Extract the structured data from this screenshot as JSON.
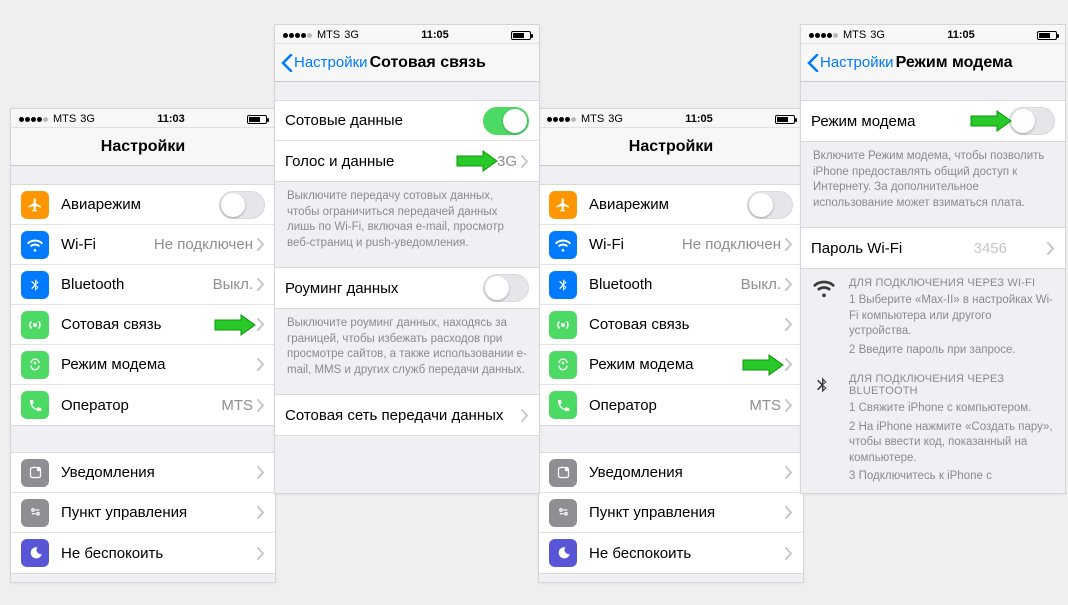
{
  "status": {
    "carrier": "MTS",
    "net": "3G",
    "t1": "11:03",
    "t2": "11:05",
    "t3": "11:05",
    "t4": "11:05"
  },
  "nav": {
    "settings": "Настройки",
    "cellular": "Сотовая связь",
    "hotspot": "Режим модема",
    "back": "Настройки"
  },
  "p1": {
    "airplane": "Авиарежим",
    "wifi": "Wi-Fi",
    "wifi_val": "Не подключен",
    "bt": "Bluetooth",
    "bt_val": "Выкл.",
    "cell": "Сотовая связь",
    "hotspot": "Режим модема",
    "carrier": "Оператор",
    "carrier_val": "MTS",
    "notif": "Уведомления",
    "cc": "Пункт управления",
    "dnd": "Не беспокоить"
  },
  "p2": {
    "celldata": "Сотовые данные",
    "voice": "Голос и данные",
    "voice_val": "3G",
    "note1": "Выключите передачу сотовых данных, чтобы ограничиться передачей данных лишь по Wi-Fi, включая e-mail, просмотр веб-страниц и push-уведомления.",
    "roam": "Роуминг данных",
    "note2": "Выключите роуминг данных, находясь за границей, чтобы избежать расходов при просмотре сайтов, а также использовании e-mail, MMS и других служб передачи данных.",
    "apn": "Сотовая сеть передачи данных"
  },
  "p4": {
    "toggle": "Режим модема",
    "note": "Включите Режим модема, чтобы позволить iPhone предоставлять общий доступ к Интернету. За дополнительное использование может взиматься плата.",
    "pw": "Пароль Wi-Fi",
    "pw_val": "3456",
    "wifi_t": "ДЛЯ ПОДКЛЮЧЕНИЯ ЧЕРЕЗ WI-FI",
    "wifi_1": "1 Выберите «Max-II» в настройках Wi-Fi компьютера или другого устройства.",
    "wifi_2": "2 Введите пароль при запросе.",
    "bt_t": "ДЛЯ ПОДКЛЮЧЕНИЯ ЧЕРЕЗ BLUETOOTH",
    "bt_1": "1 Свяжите iPhone с компьютером.",
    "bt_2": "2 На iPhone нажмите «Создать пару», чтобы ввести код, показанный на компьютере.",
    "bt_3": "3 Подключитесь к iPhone с"
  }
}
